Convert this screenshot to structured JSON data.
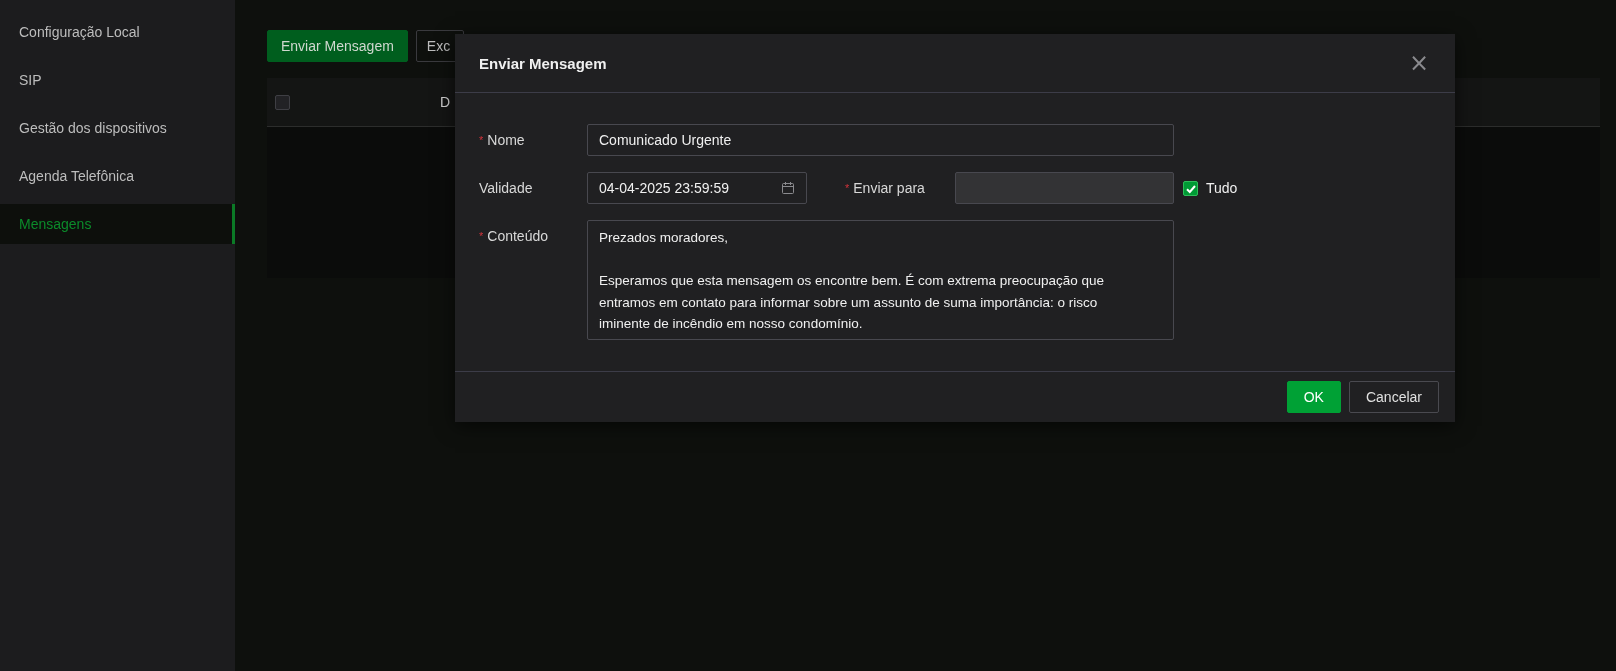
{
  "sidebar": {
    "items": [
      {
        "label": "Configuração Local",
        "selected": false
      },
      {
        "label": "SIP",
        "selected": false
      },
      {
        "label": "Gestão dos dispositivos",
        "selected": false
      },
      {
        "label": "Agenda Telefônica",
        "selected": false
      },
      {
        "label": "Mensagens",
        "selected": true
      }
    ]
  },
  "toolbar": {
    "buttons": [
      {
        "label": "Enviar Mensagem",
        "kind": "primary"
      },
      {
        "label": "Exc",
        "kind": "default"
      }
    ]
  },
  "table": {
    "select_all_checked": false,
    "columns": [
      "D"
    ]
  },
  "dialog": {
    "title": "Enviar Mensagem",
    "close": "×",
    "fields": [
      {
        "kind": "text",
        "label": "Nome",
        "required_mark": "*",
        "value": "Comunicado Urgente"
      },
      {
        "kind": "pair",
        "label": "Validade",
        "value": "04-04-2025 23:59:59",
        "second_label": "Enviar para",
        "second_required_mark": "*",
        "second_disabled": true,
        "checkbox": {
          "label": "Tudo",
          "checked": true
        }
      },
      {
        "kind": "textarea",
        "label": "Conteúdo",
        "required_mark": "*",
        "value": "Prezados moradores,\n\nEsperamos que esta mensagem os encontre bem. É com extrema preocupação que\nentramos em contato para informar sobre um assunto de suma importância: o risco\niminente de incêndio em nosso condomínio."
      }
    ],
    "buttons": [
      {
        "label": "OK",
        "kind": "primary"
      },
      {
        "label": "Cancelar",
        "kind": "default"
      }
    ]
  }
}
